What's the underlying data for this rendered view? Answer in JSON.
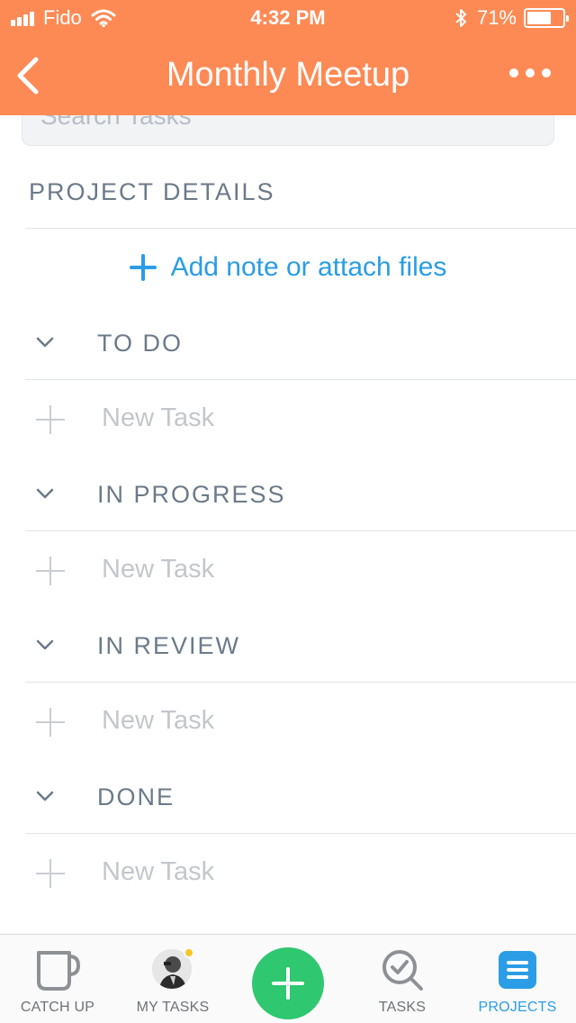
{
  "status_bar": {
    "carrier": "Fido",
    "time": "4:32 PM",
    "battery": "71%",
    "battery_level": 0.71
  },
  "header": {
    "title": "Monthly Meetup",
    "back_icon": "chevron-left-icon",
    "more_icon": "more-horizontal-icon",
    "background_color": "#fd8a55"
  },
  "search": {
    "placeholder": "Search Tasks"
  },
  "project_details": {
    "label": "PROJECT DETAILS",
    "add_note_label": "Add note or attach files"
  },
  "groups": [
    {
      "title": "TO DO",
      "new_task_placeholder": "New Task"
    },
    {
      "title": "IN PROGRESS",
      "new_task_placeholder": "New Task"
    },
    {
      "title": "IN REVIEW",
      "new_task_placeholder": "New Task"
    },
    {
      "title": "DONE",
      "new_task_placeholder": "New Task"
    }
  ],
  "tabbar": {
    "tabs": [
      {
        "label": "CATCH UP",
        "icon": "cup-icon",
        "active": false
      },
      {
        "label": "MY TASKS",
        "icon": "avatar",
        "active": false
      },
      {
        "label": "",
        "icon": "plus-icon",
        "active": false
      },
      {
        "label": "TASKS",
        "icon": "search-check-icon",
        "active": false
      },
      {
        "label": "PROJECTS",
        "icon": "list-icon",
        "active": true
      }
    ],
    "accent_color": "#2a9de6",
    "fab_color": "#2fc76f"
  }
}
